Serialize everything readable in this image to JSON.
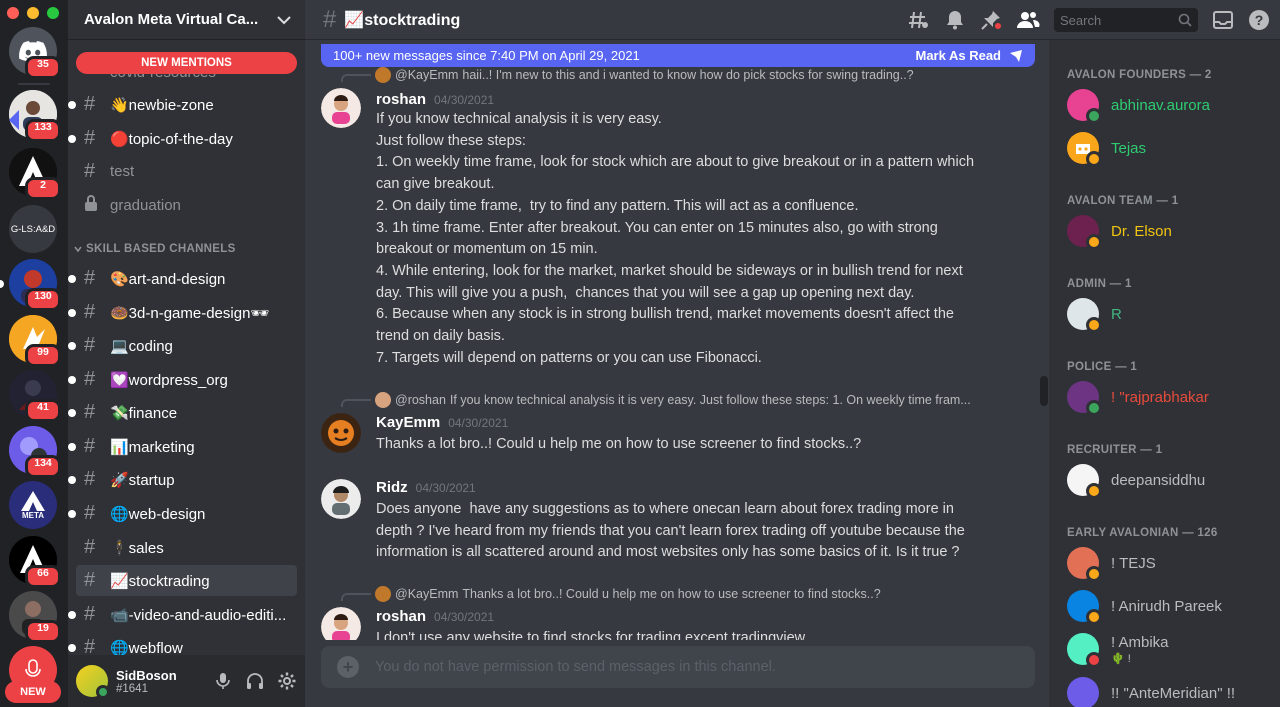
{
  "colors": {
    "accent": "#5865f2",
    "danger": "#ed4245",
    "online": "#3ba55d",
    "idle": "#faa81a",
    "founder_green": "#2ecc71",
    "team_yellow": "#f1c40f",
    "admin_green": "#43b581",
    "police_red": "#e74c3c"
  },
  "servers": [
    {
      "icon": "discord-home-icon",
      "badge": "35"
    },
    {
      "icon": "server-avatar-icon",
      "badge": "133"
    },
    {
      "icon": "server-avatar-icon",
      "badge": "2"
    },
    {
      "icon": "server-text-icon",
      "label": "G-LS:A&D",
      "badge": ""
    },
    {
      "icon": "server-avatar-icon",
      "badge": "130"
    },
    {
      "icon": "server-avatar-icon",
      "badge": "99"
    },
    {
      "icon": "server-avatar-icon",
      "badge": "41"
    },
    {
      "icon": "server-avatar-icon",
      "badge": "134"
    },
    {
      "icon": "server-avatar-icon",
      "label": "META",
      "badge": ""
    },
    {
      "icon": "server-avatar-icon",
      "badge": "66"
    },
    {
      "icon": "server-avatar-icon",
      "badge": "19"
    },
    {
      "icon": "server-avatar-icon",
      "badge": ""
    }
  ],
  "rail": {
    "new_label": "NEW"
  },
  "sidebar": {
    "server_name": "Avalon Meta Virtual Ca...",
    "new_mentions": "NEW MENTIONS",
    "ghost_channel": "covid-resources",
    "category": "SKILL BASED CHANNELS",
    "channels_top": [
      {
        "name": "👋newbie-zone",
        "unread": true
      },
      {
        "name": "🔴topic-of-the-day",
        "unread": true
      },
      {
        "name": "test",
        "unread": false
      },
      {
        "name": "graduation",
        "unread": false,
        "locked": true
      }
    ],
    "channels": [
      {
        "name": "🎨art-and-design",
        "unread": true
      },
      {
        "name": "🍩3d-n-game-design🕶",
        "unread": true
      },
      {
        "name": "💻coding",
        "unread": true
      },
      {
        "name": "💟wordpress_org",
        "unread": true
      },
      {
        "name": "💸finance",
        "unread": true
      },
      {
        "name": "📊marketing",
        "unread": true
      },
      {
        "name": "🚀startup",
        "unread": true
      },
      {
        "name": "🌐web-design",
        "unread": true
      },
      {
        "name": "🕴sales",
        "unread": true
      },
      {
        "name": "📈stocktrading",
        "unread": false,
        "active": true
      },
      {
        "name": "📹-video-and-audio-editi...",
        "unread": true
      },
      {
        "name": "🌐webflow",
        "unread": true
      }
    ],
    "user": {
      "name": "SidBoson",
      "tag": "#1641"
    }
  },
  "header": {
    "channel": "📈stocktrading",
    "search_placeholder": "Search"
  },
  "banner": {
    "text": "100+ new messages since 7:40 PM on April 29, 2021",
    "action": "Mark As Read"
  },
  "messages": [
    {
      "reply_to": "@KayEmm",
      "reply_text": "haii..! I'm new to this and i wanted to know how do pick stocks for swing trading..?",
      "author": "roshan",
      "time": "04/30/2021",
      "lines": [
        "If you know technical analysis it is very easy.",
        "Just follow these steps:",
        "1. On weekly time frame, look for stock which are about to give breakout or in a pattern which",
        "can give breakout.",
        "2. On daily time frame,  try to find any pattern. This will act as a confluence.",
        "3. 1h time frame. Enter after breakout. You can enter on 15 minutes also, go with strong",
        "breakout or momentum on 15 min.",
        "4. While entering, look for the market, market should be sideways or in bullish trend for next",
        "day. This will give you a push,  chances that you will see a gap up opening next day.",
        "6. Because when any stock is in strong bullish trend, market movements doesn't affect the",
        "trend on daily basis.",
        "7. Targets will depend on patterns or you can use Fibonacci."
      ]
    },
    {
      "reply_to": "@roshan",
      "reply_text": "If you know technical analysis it is very easy.  Just follow these steps: 1. On weekly time fram...",
      "author": "KayEmm",
      "time": "04/30/2021",
      "lines": [
        "Thanks a lot bro..! Could u help me on how to use screener to find stocks..?"
      ]
    },
    {
      "author": "Ridz",
      "time": "04/30/2021",
      "lines": [
        "Does anyone  have any suggestions as to where onecan learn about forex trading more in",
        "depth ? I've heard from my friends that you can't learn forex trading off youtube because the",
        "information is all scattered around and most websites only has some basics of it. Is it true ?"
      ]
    },
    {
      "reply_to": "@KayEmm",
      "reply_text": "Thanks a lot bro..! Could u help me on how to use screener to find stocks..?",
      "author": "roshan",
      "time": "04/30/2021",
      "lines": [
        "I don't use any website to find stocks for trading except tradingview."
      ]
    }
  ],
  "composer": {
    "placeholder": "You do not have permission to send messages in this channel."
  },
  "members": {
    "roles": [
      {
        "title": "AVALON FOUNDERS — 2"
      },
      {
        "title": "AVALON TEAM — 1"
      },
      {
        "title": "ADMIN — 1"
      },
      {
        "title": "POLICE — 1"
      },
      {
        "title": "RECRUITER — 1"
      },
      {
        "title": "EARLY AVALONIAN — 126"
      }
    ],
    "people": [
      {
        "name": "abhinav.aurora",
        "color": "#2ecc71"
      },
      {
        "name": "Tejas",
        "color": "#2ecc71"
      },
      {
        "name": "Dr. Elson",
        "color": "#f1c40f"
      },
      {
        "name": "R",
        "color": "#43b581"
      },
      {
        "name": "! \"rajprabhakar",
        "color": "#e74c3c"
      },
      {
        "name": "deepansiddhu",
        "color": "#b9bbbe"
      },
      {
        "name": "! TEJS",
        "color": "#b9bbbe"
      },
      {
        "name": "! Anirudh Pareek",
        "color": "#b9bbbe"
      },
      {
        "name": "! Ambika",
        "color": "#b9bbbe",
        "sub": "🌵 !"
      },
      {
        "name": "!! \"AnteMeridian\" !!",
        "color": "#b9bbbe"
      }
    ]
  }
}
